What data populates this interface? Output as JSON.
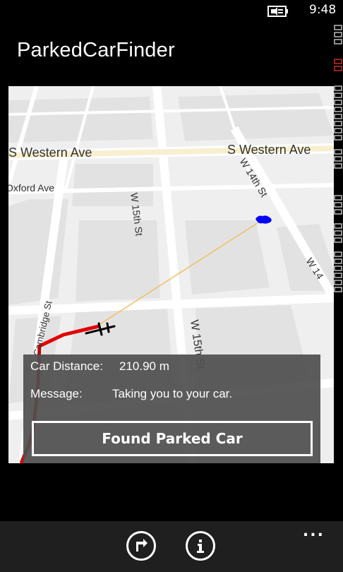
{
  "status_bar": {
    "time": "9:48",
    "battery_icon": "battery-charging-icon"
  },
  "app": {
    "title": "ParkedCarFinder"
  },
  "map": {
    "streets": {
      "western_left": "S Western Ave",
      "western_right": "S Western Ave",
      "oxford": "Oxford Ave",
      "w15_upper": "W 15th St",
      "w15_lower": "W 15th St",
      "w14": "W 14th St",
      "w_right": "W 14",
      "cambridge": "Cambridge St"
    },
    "colors": {
      "route": "#e00000",
      "guide_line": "#f0c060",
      "car_marker": "#0000ff"
    },
    "icons": [
      "car-marker-icon",
      "plane-marker-icon"
    ]
  },
  "info_panel": {
    "distance_label": "Car Distance:",
    "distance_value": "210.90 m",
    "message_label": "Message:",
    "message_value": "Taking you to your car.",
    "found_button": "Found Parked Car"
  },
  "app_bar": {
    "buttons": [
      "directions-icon",
      "info-icon"
    ],
    "more": "..."
  }
}
